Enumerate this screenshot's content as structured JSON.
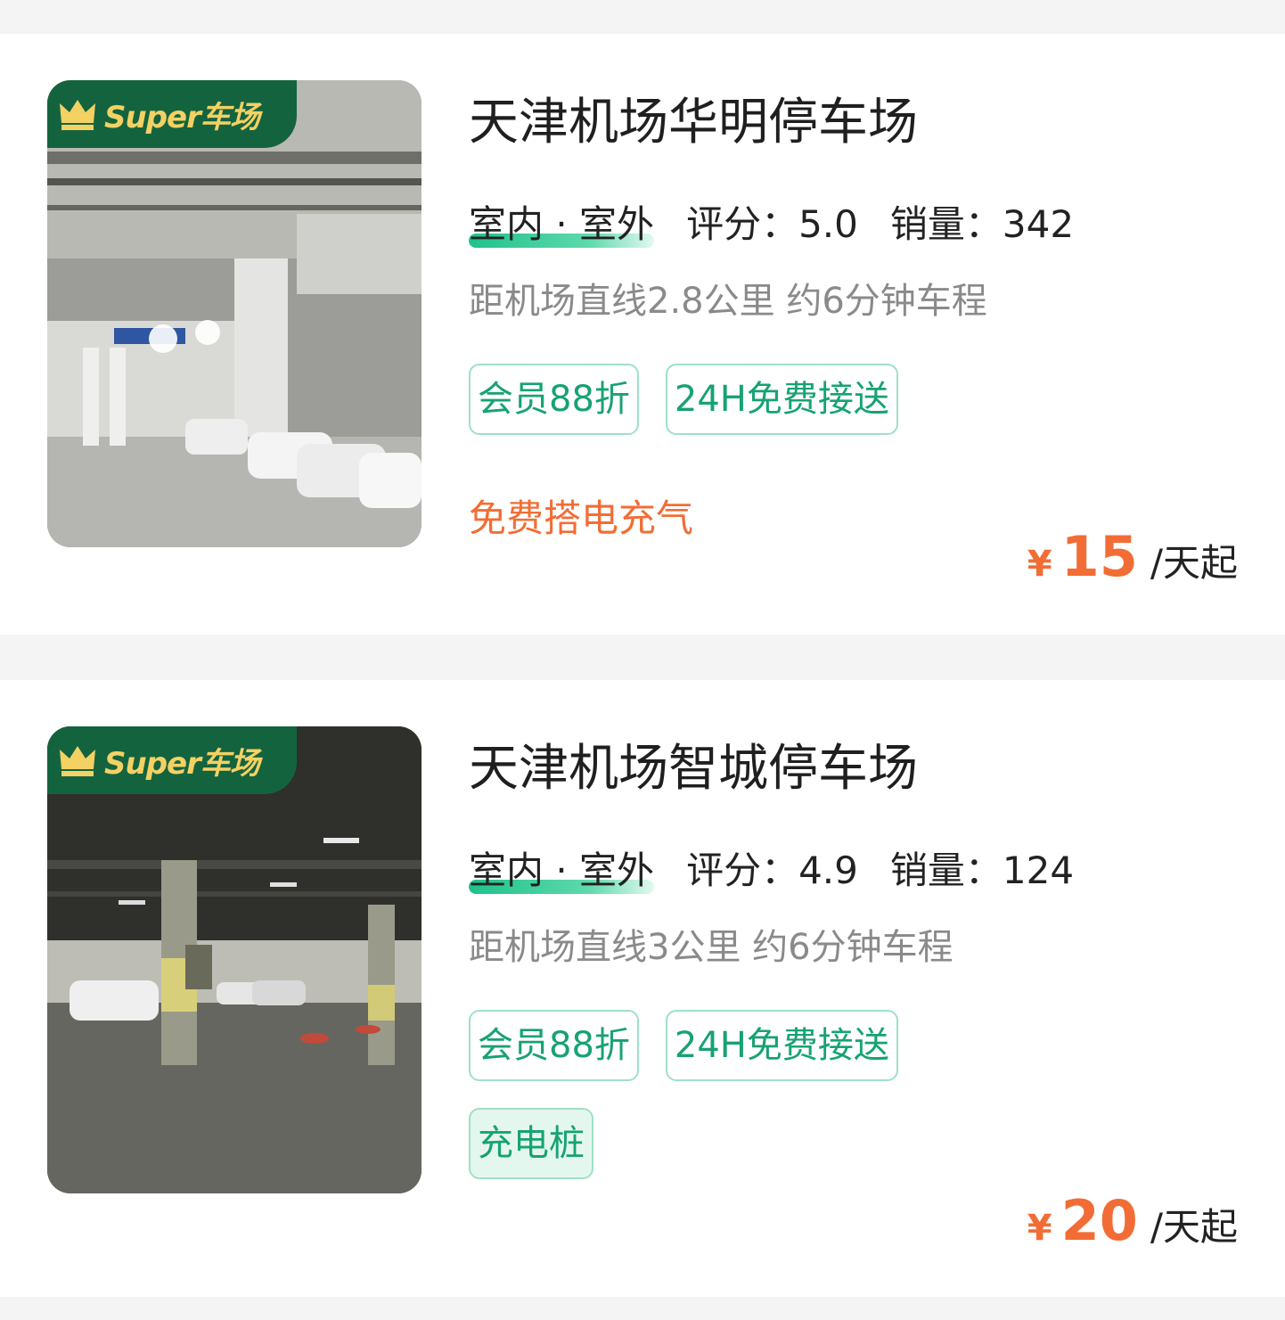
{
  "listings": [
    {
      "badge": "Super车场",
      "name": "天津机场华明停车场",
      "type": "室内 · 室外",
      "rating_label": "评分：",
      "rating": "5.0",
      "sales_label": "销量：",
      "sales": "342",
      "distance": "距机场直线2.8公里 约6分钟车程",
      "tags": [
        "会员88折",
        "24H免费接送"
      ],
      "promo": "免费搭电充气",
      "currency": "¥",
      "price": "15",
      "unit": "/天起"
    },
    {
      "badge": "Super车场",
      "name": "天津机场智城停车场",
      "type": "室内 · 室外",
      "rating_label": "评分：",
      "rating": "4.9",
      "sales_label": "销量：",
      "sales": "124",
      "distance": "距机场直线3公里 约6分钟车程",
      "tags": [
        "会员88折",
        "24H免费接送"
      ],
      "extra_tag": "充电桩",
      "currency": "¥",
      "price": "20",
      "unit": "/天起"
    }
  ],
  "colors": {
    "badge_bg": "#14633f",
    "badge_text": "#f3d163",
    "tag_green": "#17a273",
    "price_orange": "#f26d35",
    "promo_orange": "#f26d35"
  },
  "icons": [
    "crown-icon"
  ]
}
